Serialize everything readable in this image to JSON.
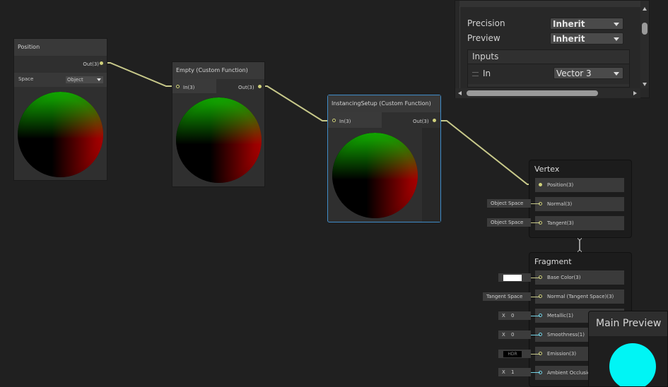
{
  "nodes": {
    "position": {
      "title": "Position",
      "out_label": "Out(3)",
      "space_label": "Space",
      "space_value": "Object"
    },
    "empty": {
      "title": "Empty (Custom Function)",
      "in_label": "In(3)",
      "out_label": "Out(3)"
    },
    "instancing": {
      "title": "InstancingSetup (Custom Function)",
      "in_label": "In(3)",
      "out_label": "Out(3)"
    }
  },
  "vertex": {
    "title": "Vertex",
    "slots": [
      {
        "label": "Position(3)",
        "ext": ""
      },
      {
        "label": "Normal(3)",
        "ext": "Object Space"
      },
      {
        "label": "Tangent(3)",
        "ext": "Object Space"
      }
    ]
  },
  "fragment": {
    "title": "Fragment",
    "slots": [
      {
        "label": "Base Color(3)",
        "ext": ""
      },
      {
        "label": "Normal (Tangent Space)(3)",
        "ext": "Tangent Space"
      },
      {
        "label": "Metallic(1)",
        "ext_x": "X",
        "ext_val": "0"
      },
      {
        "label": "Smoothness(1)",
        "ext_x": "X",
        "ext_val": "0"
      },
      {
        "label": "Emission(3)",
        "ext": "HDR"
      },
      {
        "label": "Ambient Occlusion",
        "ext_x": "X",
        "ext_val": "1"
      }
    ]
  },
  "inspector": {
    "precision_label": "Precision",
    "precision_value": "Inherit",
    "preview_label": "Preview",
    "preview_value": "Inherit",
    "inputs_header": "Inputs",
    "input_name": "In",
    "input_type": "Vector 3"
  },
  "main_preview": {
    "title": "Main Preview"
  },
  "colors": {
    "edge": "#c8c98a",
    "accent_selected": "#3f8cc9",
    "preview_sphere": "#00f5f5"
  }
}
